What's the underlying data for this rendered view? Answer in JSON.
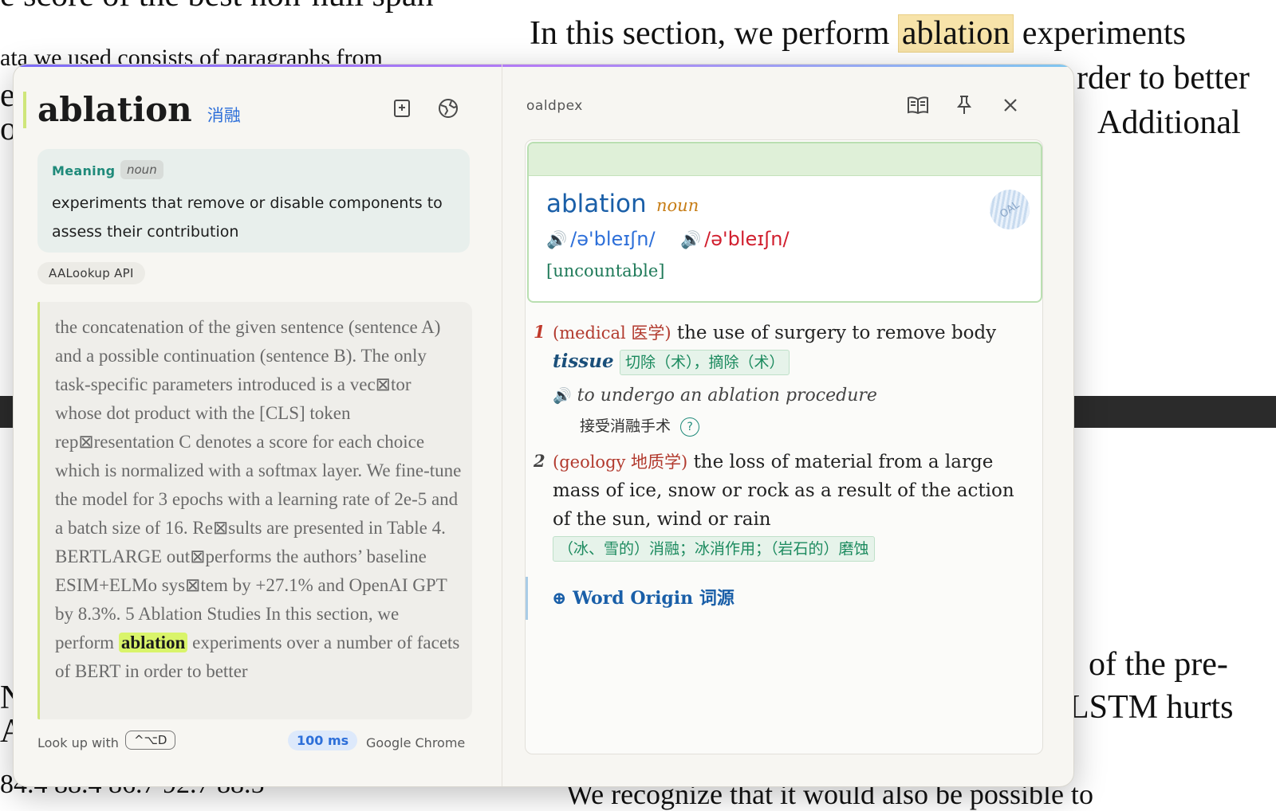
{
  "background": {
    "line1": "e score of the best non-null span",
    "line2": "ata we used consists of paragraphs from",
    "right_line1_pre": "In this section, we perform",
    "right_line1_hl": "ablation",
    "right_line1_post": "experiments",
    "right_line2": "rder to better",
    "right_line3": "Additional",
    "right_line4": "of the pre-",
    "right_line5": "LSTM hurts",
    "left_frag1": "e",
    "left_frag2": "or",
    "left_frag3": "N",
    "left_frag4": "A",
    "bottom_left": "84.4     88.4     86.7     92.7     88.5",
    "bottom_right": "We recognize that it would also be possible to"
  },
  "popup": {
    "headword": "ablation",
    "headword_translation": "消融",
    "meaning": {
      "label": "Meaning",
      "pos": "noun",
      "text": "experiments that remove or disable components to assess their contribution"
    },
    "source": "AALookup API",
    "context": {
      "before": "the concatenation of the given sentence (sentence A) and a possible continuation (sentence B). The only task-specific parameters introduced is a vec⊠tor whose dot product with the [CLS] token rep⊠resentation C denotes a score for each choice which is normalized with a softmax layer. We fine-tune the model for 3 epochs with a learning rate of 2e-5 and a batch size of 16. Re⊠sults are presented in Table 4. BERTLARGE out⊠performs the authors’ baseline ESIM+ELMo sys⊠tem by +27.1% and OpenAI GPT by 8.3%. 5 Ablation Studies In this section, we perform",
      "highlight": "ablation",
      "after": "experiments over a number of facets of BERT in order to better"
    },
    "footer": {
      "lookup_label": "Look up with",
      "shortcut": "^⌥D",
      "latency": "100 ms",
      "app": "Google Chrome"
    }
  },
  "dictionary": {
    "name": "oaldpex",
    "entry_word": "ablation",
    "entry_pos": "noun",
    "pron_br": "/ə'bleɪʃn/",
    "pron_am": "/ə'bleɪʃn/",
    "grammar": "[uncountable]",
    "stamp": "OAL",
    "senses": [
      {
        "num": "1",
        "label": "(medical 医学)",
        "def_a": "the use of surgery to remove body",
        "def_b": "tissue",
        "zh": "切除（术），摘除（术）",
        "example": "to undergo an ablation procedure",
        "example_zh": "接受消融手术"
      },
      {
        "num": "2",
        "label": "(geology 地质学)",
        "def": "the loss of material from a large mass of ice, snow or rock as a result of the action of the sun, wind or rain",
        "zh": "（冰、雪的）消融；冰消作用；（岩石的）磨蚀"
      }
    ],
    "word_origin": "⊕ Word Origin 词源"
  },
  "colors": {
    "accent_blue": "#2d6fd9",
    "highlight_green": "#d9f46a",
    "teal": "#1f8a7a",
    "am_red": "#d11f2e"
  },
  "icons": [
    "add-bookmark-icon",
    "globe-icon",
    "book-icon",
    "pin-icon",
    "close-icon",
    "speaker-icon",
    "help-icon"
  ]
}
